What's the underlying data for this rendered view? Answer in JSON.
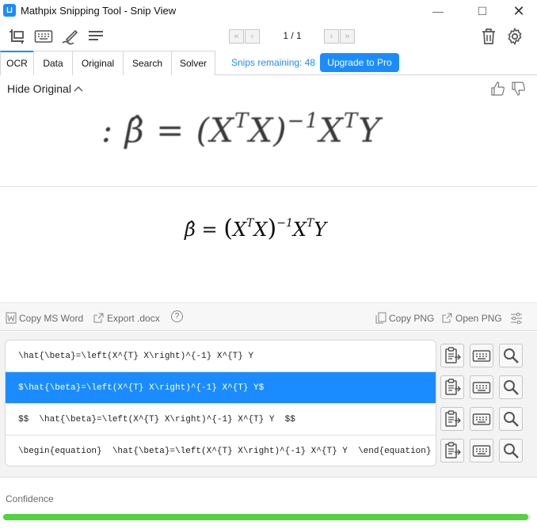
{
  "window": {
    "app_icon": "mathpix-logo",
    "title": "Mathpix Snipping Tool - Snip View",
    "min_glyph": "—",
    "max_glyph": "☐",
    "close_glyph": "✕"
  },
  "toolbar": {
    "icons": [
      "screenshot-icon",
      "keyboard-icon",
      "handwriting-icon",
      "menu-icon"
    ],
    "first_glyph": "«",
    "prev_glyph": "‹",
    "page_count": "1 / 1",
    "next_glyph": "›",
    "last_glyph": "»",
    "right_icons": [
      "trash-icon",
      "gear-icon"
    ]
  },
  "tabs": [
    {
      "label": "OCR",
      "active": true
    },
    {
      "label": "Data",
      "active": false
    },
    {
      "label": "Original",
      "active": false
    },
    {
      "label": "Search",
      "active": false
    },
    {
      "label": "Solver",
      "active": false
    }
  ],
  "snips_remaining": "Snips remaining: 48",
  "upgrade_label": "Upgrade to Pro",
  "original": {
    "hide_label": "Hide Original",
    "feedback_icons": [
      "thumbs-up-icon",
      "thumbs-down-icon"
    ]
  },
  "copybar": {
    "copy_ms_word": "Copy MS Word",
    "export_docx": "Export .docx",
    "help_glyph": "?",
    "copy_png": "Copy PNG",
    "open_png": "Open PNG"
  },
  "latex_results": [
    {
      "text": "\\hat{\\beta}=\\left(X^{T} X\\right)^{-1} X^{T} Y",
      "selected": false
    },
    {
      "text": "$\\hat{\\beta}=\\left(X^{T} X\\right)^{-1} X^{T} Y$",
      "selected": true
    },
    {
      "text": "$$  \\hat{\\beta}=\\left(X^{T} X\\right)^{-1} X^{T} Y  $$",
      "selected": false
    },
    {
      "text": "\\begin{equation}  \\hat{\\beta}=\\left(X^{T} X\\right)^{-1} X^{T} Y  \\end{equation}",
      "selected": false
    }
  ],
  "row_actions": [
    "clipboard-icon",
    "keyboard-icon",
    "search-icon"
  ],
  "confidence": {
    "label": "Confidence",
    "value": 0.995
  },
  "colors": {
    "accent": "#1a8cff",
    "confidence": "#55d23f"
  }
}
